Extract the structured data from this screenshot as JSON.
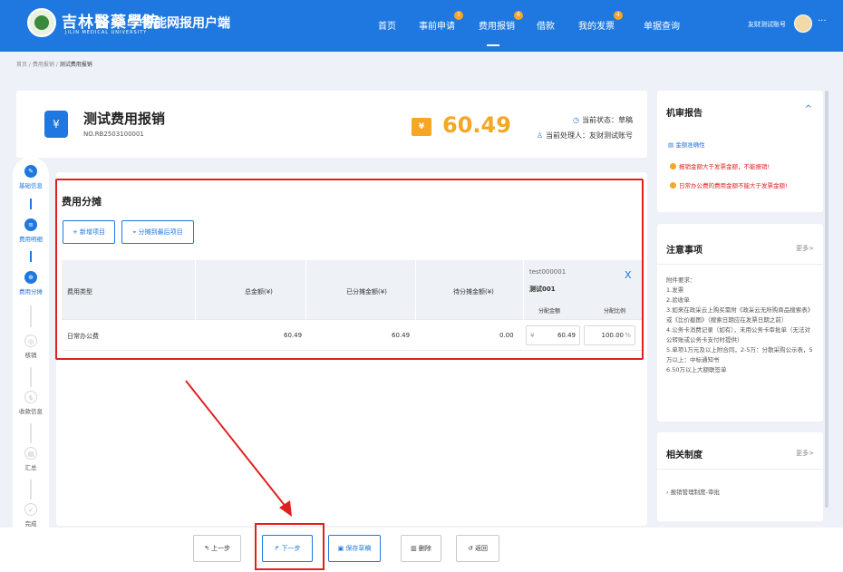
{
  "topbar": {
    "logo_text": "吉林醫藥學院",
    "logo_en": "JILIN MEDICAL UNIVERSITY",
    "app_title": "智能网报用户端",
    "nav": [
      {
        "label": "首页",
        "badge": ""
      },
      {
        "label": "事前申请",
        "badge": "1"
      },
      {
        "label": "费用报销",
        "badge": "6"
      },
      {
        "label": "借款",
        "badge": ""
      },
      {
        "label": "我的发票",
        "badge": "4"
      },
      {
        "label": "单据查询",
        "badge": ""
      }
    ],
    "account": "友财测试账号",
    "more": "···"
  },
  "breadcrumb": [
    "首页",
    "费用报销",
    "测试费用报销"
  ],
  "header": {
    "title": "测试费用报销",
    "doc_no": "NO.RB2503100001",
    "amount": "60.49",
    "status_label": "当前状态：",
    "status_value": "草稿",
    "handler_label": "当前处理人：",
    "handler_value": "友财测试账号"
  },
  "steps": [
    {
      "label": "基础信息",
      "active": true
    },
    {
      "label": "费用明细",
      "active": true
    },
    {
      "label": "费用分摊",
      "active": true
    },
    {
      "label": "核销",
      "active": false
    },
    {
      "label": "收款信息",
      "active": false
    },
    {
      "label": "汇总",
      "active": false
    },
    {
      "label": "完成",
      "active": false
    }
  ],
  "allocation": {
    "title": "费用分摊",
    "add_btn": "+ 新增项目",
    "alloc_last_btn": "分摊到最后项目",
    "columns": {
      "type": "费用类型",
      "total": "总金额(¥)",
      "allocated": "已分摊金额(¥)",
      "pending": "待分摊金额(¥)"
    },
    "project": {
      "code": "test000001",
      "name": "测试001",
      "amount_label": "分配金额",
      "ratio_label": "分配比例"
    },
    "rows": [
      {
        "type": "日常办公费",
        "total": "60.49",
        "allocated": "60.49",
        "pending": "0.00",
        "currency": "¥",
        "amount": "60.49",
        "ratio": "100.00",
        "ratio_unit": "%"
      }
    ]
  },
  "bottom": {
    "prev": "上一步",
    "next": "下一步",
    "save": "保存草稿",
    "delete": "删除",
    "back": "返回"
  },
  "audit": {
    "title": "机审报告",
    "item": "金额准确性",
    "warnings": [
      "报销金额大于发票金额，不能报销!",
      "日常办公费的费用金额不能大于发票金额!"
    ]
  },
  "notes": {
    "title": "注意事项",
    "more": "更多>",
    "lines": [
      "附件要求：",
      "1.发票",
      "2.验收单",
      "3.如来在政采云上购买需附《政采云无所购商品搜索表》或《比价截图》（搜索日期应在发票日期之前）",
      "4.公务卡消费记录（如有），未用公务卡审批单（无法对公转账或公务卡支付时提供）",
      "5.单项1万元及以上附合同，2-5万：分散采购公示表，5万以上：中标通知书",
      "6.50万以上大额联签单"
    ]
  },
  "policy": {
    "title": "相关制度",
    "more": "更多>",
    "item": "报销管理制度-审批"
  },
  "colors": {
    "primary": "#1e78e0",
    "accent": "#f5a623",
    "highlight": "#e02020"
  }
}
